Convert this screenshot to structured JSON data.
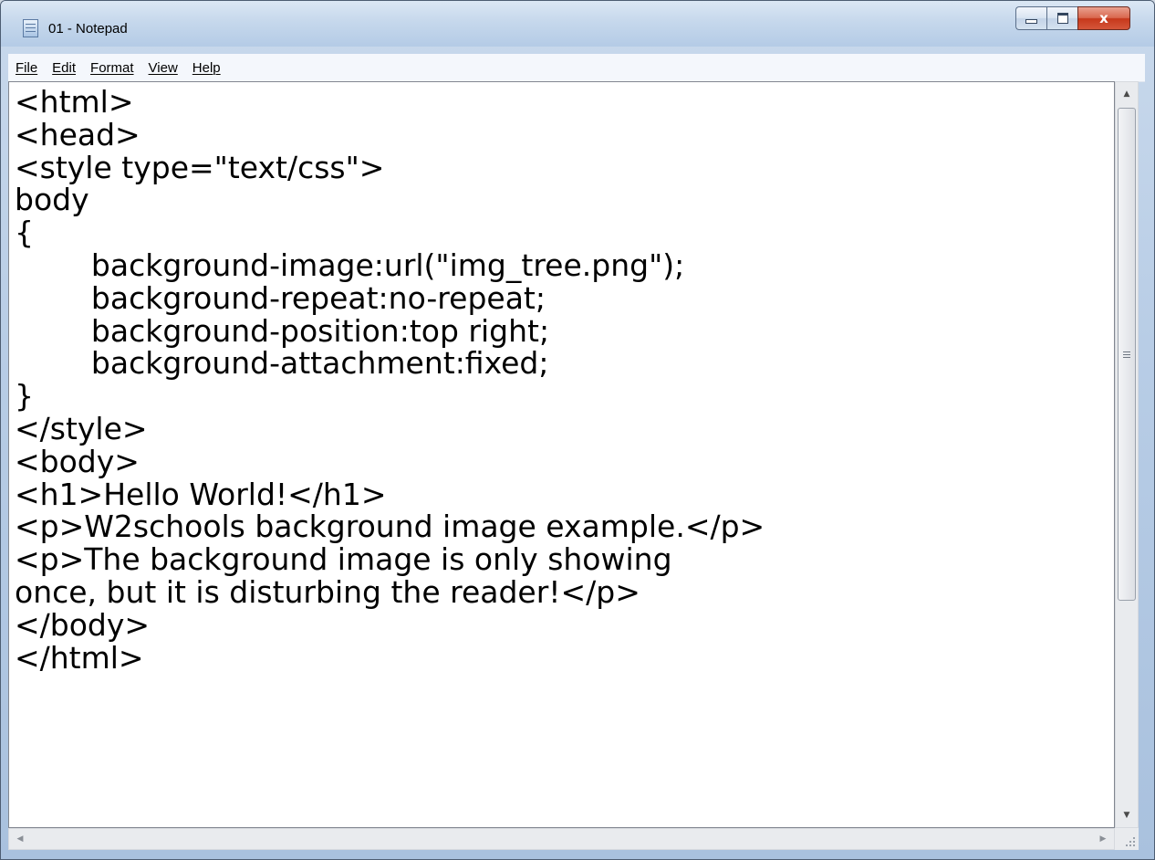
{
  "window": {
    "title": "01 - Notepad"
  },
  "menu": [
    {
      "label": "File"
    },
    {
      "label": "Edit"
    },
    {
      "label": "Format"
    },
    {
      "label": "View"
    },
    {
      "label": "Help"
    }
  ],
  "caption_buttons": {
    "close_glyph": "x"
  },
  "editor": {
    "lines": [
      "<html>",
      "<head>",
      "<style type=\"text/css\">",
      "body",
      "{",
      "        background-image:url(\"img_tree.png\");",
      "        background-repeat:no-repeat;",
      "        background-position:top right;",
      "        background-attachment:fixed;",
      "}",
      "</style>",
      "<body>",
      "<h1>Hello World!</h1>",
      "<p>W2schools background image example.</p>",
      "<p>The background image is only showing",
      "once, but it is disturbing the reader!</p>",
      "</body>",
      "</html>"
    ]
  },
  "icons": {
    "app": "notepad-icon",
    "scroll_up": "scroll-up-arrow-icon",
    "scroll_down": "scroll-down-arrow-icon",
    "scroll_left": "scroll-left-arrow-icon",
    "scroll_right": "scroll-right-arrow-icon"
  },
  "colors": {
    "frame": "#b8cde6",
    "close_button": "#c6381b",
    "editor_background": "#ffffff",
    "text": "#000000"
  }
}
